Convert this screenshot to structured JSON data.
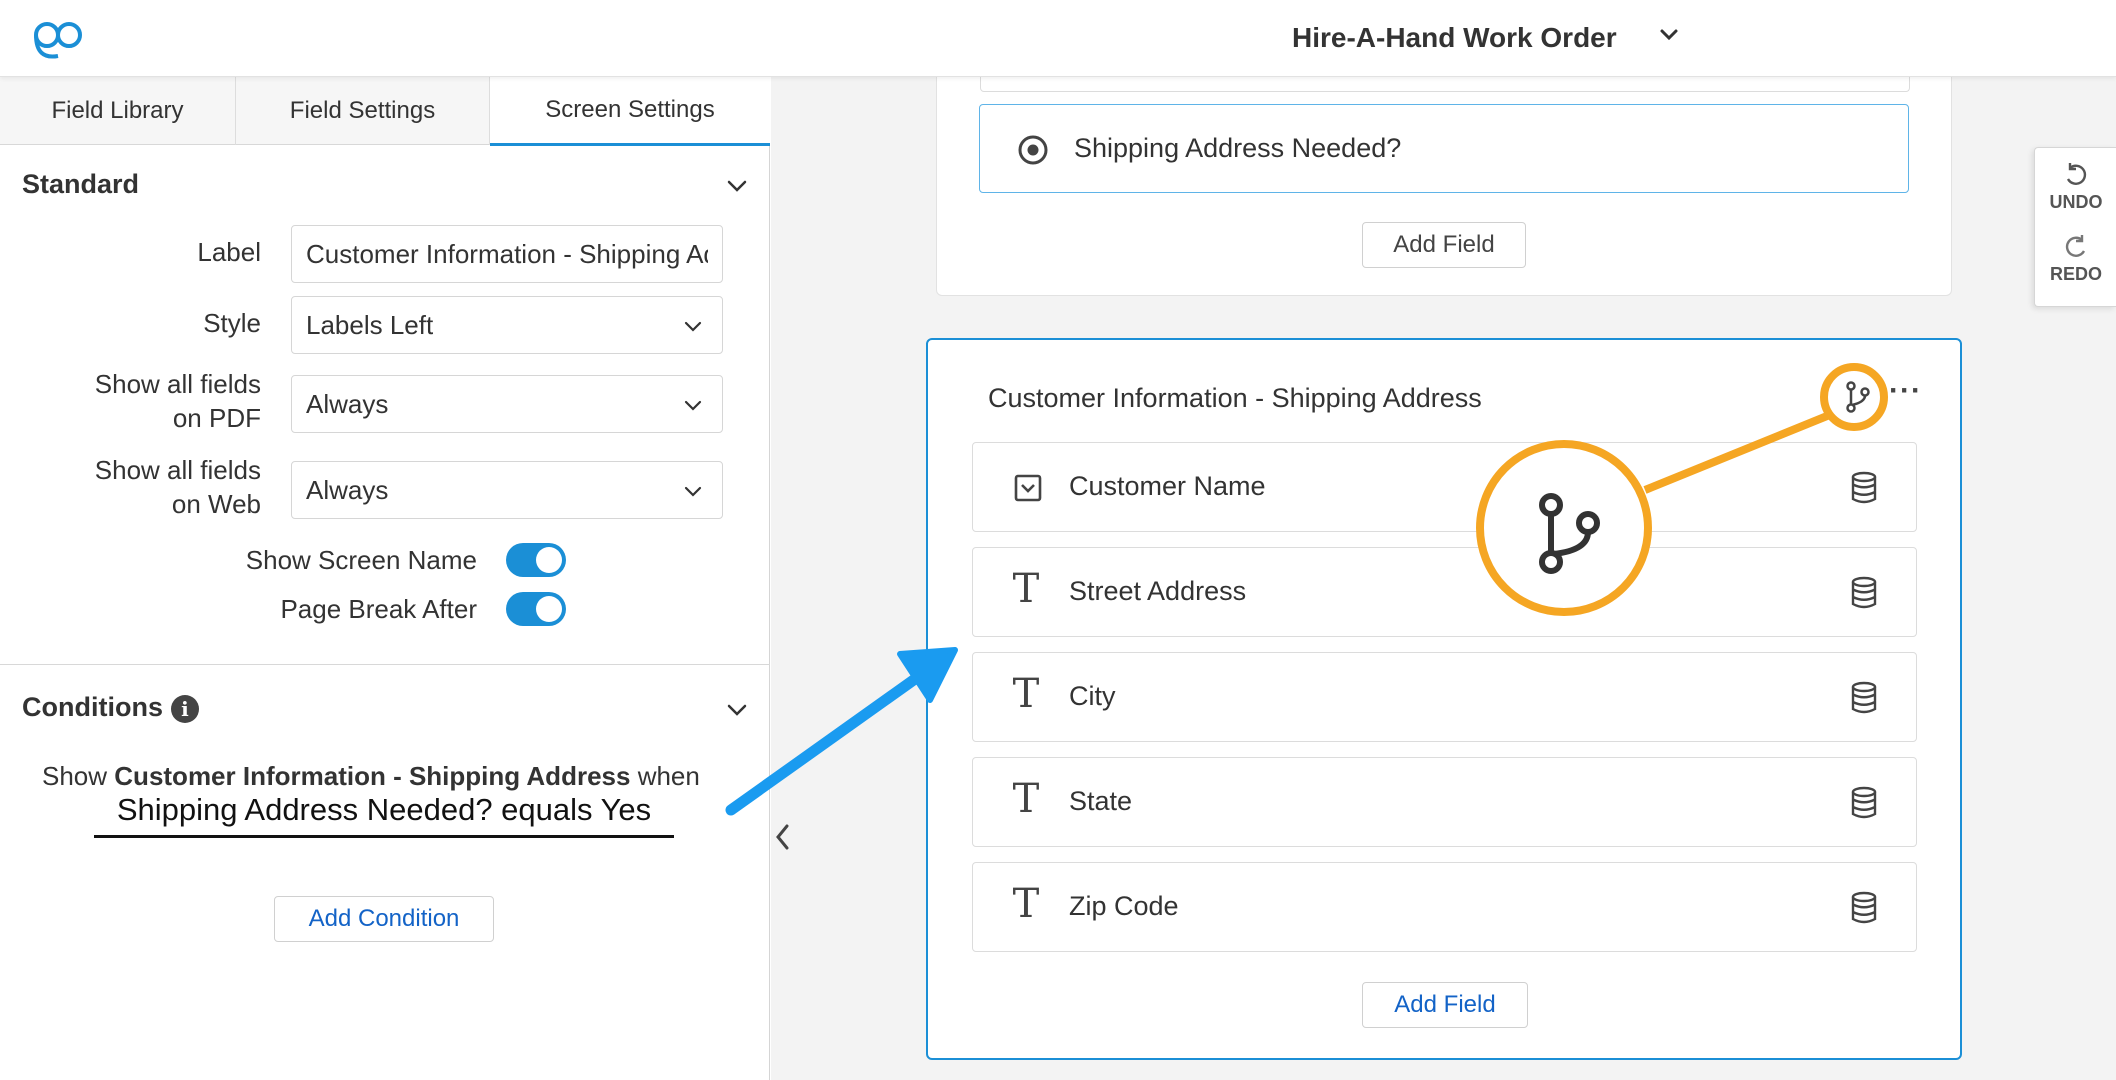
{
  "header": {
    "title": "Hire-A-Hand Work Order"
  },
  "tabs": [
    {
      "label": "Field Library"
    },
    {
      "label": "Field Settings"
    },
    {
      "label": "Screen Settings"
    }
  ],
  "standard": {
    "title": "Standard",
    "label_label": "Label",
    "label_value": "Customer Information - Shipping Address",
    "style_label": "Style",
    "style_value": "Labels Left",
    "pdf_label_line1": "Show all fields",
    "pdf_label_line2": "on PDF",
    "pdf_value": "Always",
    "web_label_line1": "Show all fields",
    "web_label_line2": "on Web",
    "web_value": "Always",
    "show_screen_name_label": "Show Screen Name",
    "page_break_label": "Page Break After"
  },
  "conditions": {
    "title": "Conditions",
    "show_prefix": "Show",
    "screen_name": "Customer Information - Shipping Address",
    "show_suffix": "when",
    "rule": "Shipping Address Needed? equals Yes",
    "add_button": "Add Condition"
  },
  "canvas": {
    "prev_field": "Shipping Address Needed?",
    "add_field_label": "Add Field",
    "screen_title": "Customer Information - Shipping Address",
    "fields": [
      {
        "label": "Customer Name",
        "icon": "dropdown-icon"
      },
      {
        "label": "Street Address",
        "icon": "text-icon"
      },
      {
        "label": "City",
        "icon": "text-icon"
      },
      {
        "label": "State",
        "icon": "text-icon"
      },
      {
        "label": "Zip Code",
        "icon": "text-icon"
      }
    ]
  },
  "history": {
    "undo_label": "UNDO",
    "redo_label": "REDO"
  },
  "colors": {
    "accent": "#1b8fd6",
    "highlight": "#f5a623",
    "arrow": "#1a9bf0",
    "link": "#1363c7"
  }
}
